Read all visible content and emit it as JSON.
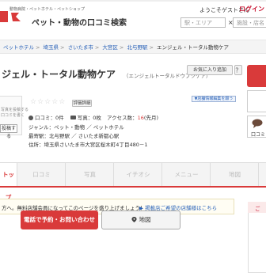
{
  "header": {
    "tagline": "動物病院・ペットホテル・ペットショップ",
    "brand": "ペット・動物の口コミ検索",
    "welcome": "ようこそゲストさん",
    "login": "ログイン",
    "search_area_placeholder": "駅・エリア",
    "search_sep": "×",
    "search_keyword_placeholder": "施設・店名"
  },
  "breadcrumb": [
    {
      "label": "ペットホテル",
      "link": true
    },
    {
      "label": "埼玉県",
      "link": true
    },
    {
      "label": "さいたま市",
      "link": true
    },
    {
      "label": "大宮区",
      "link": true
    },
    {
      "label": "北与野駅",
      "link": true
    },
    {
      "label": "エンジェル・トータル動物ケア",
      "link": false
    }
  ],
  "facility": {
    "title": "ジェル・トータル動物ケア",
    "kana": "（エンジェルトータルドウブツケア）",
    "favorite_label": "お気に入り追加",
    "help_label": "？",
    "stars": "☆☆☆☆☆",
    "rating_badge": "評価詳細",
    "edit_link": "▼店舗情報編集を願う",
    "review_label": "口コミ：",
    "review_count": "0件",
    "photo_label": "写真：",
    "photo_count": "0枚",
    "access_label": "アクセス数：",
    "access_count": "16",
    "access_unit": "(先月)",
    "genre": "ジャンル：ペット・動物 ／ ペットホテル",
    "station": "最寄駅：北与野駅 ／ さいたま新都心駅",
    "address": "住所：埼玉県さいたま市大宮区桜木町4丁目480－1"
  },
  "side_card": {
    "text_line1": "写真を投稿する",
    "text_line2": "口コミを書く",
    "button": "投稿する"
  },
  "side_actions": {
    "review_label": "口コミ"
  },
  "tabs": [
    {
      "label": "トップ",
      "active": true
    },
    {
      "label": "口コミ",
      "active": false
    },
    {
      "label": "写真",
      "active": false
    },
    {
      "label": "イチオシ",
      "active": false
    },
    {
      "label": "メニュー",
      "active": false
    },
    {
      "label": "地図",
      "active": false
    }
  ],
  "notice": {
    "text": "方へ。無料店舗会員になってこのページを盛り上げましょう！",
    "link": "▶ 掲載店ご希望の店舗様はこちら"
  },
  "side_panel": {
    "header": "ご"
  },
  "cta": {
    "call": "電話で予約・お問い合わせ",
    "map": "地図"
  },
  "colors": {
    "accent": "#d93a3a",
    "link": "#2a62b8"
  }
}
